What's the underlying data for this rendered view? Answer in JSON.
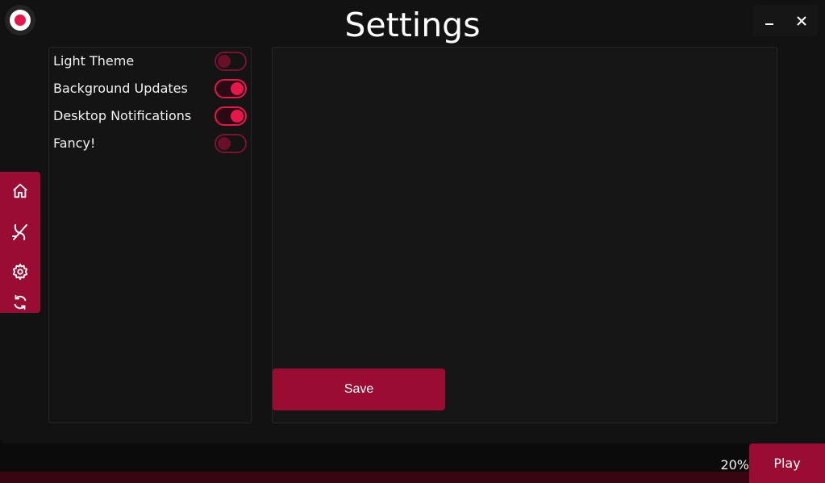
{
  "window": {
    "title": "Settings",
    "controls": {
      "minimize_icon": "minimize-icon",
      "close_icon": "close-icon"
    }
  },
  "settings": {
    "items": [
      {
        "label": "Light Theme",
        "enabled": false
      },
      {
        "label": "Background Updates",
        "enabled": true
      },
      {
        "label": "Desktop Notifications",
        "enabled": true
      },
      {
        "label": "Fancy!",
        "enabled": false
      }
    ]
  },
  "content": {
    "save_label": "Save"
  },
  "sidebar": {
    "items": [
      {
        "icon": "home-icon"
      },
      {
        "icon": "mods-icon"
      },
      {
        "icon": "gear-icon"
      },
      {
        "icon": "refresh-icon"
      }
    ]
  },
  "status": {
    "progress_label": "20%",
    "progress_value": 20,
    "play_label": "Play"
  },
  "colors": {
    "accent": "#e8174b",
    "accent_dark": "#9b0c33",
    "background": "#121212",
    "panel": "#161616"
  }
}
